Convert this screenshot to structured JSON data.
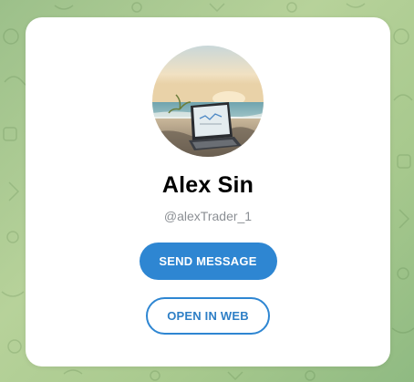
{
  "profile": {
    "name": "Alex Sin",
    "username": "@alexTrader_1",
    "avatar_icon": "avatar-laptop-on-beach"
  },
  "actions": {
    "send_message_label": "SEND MESSAGE",
    "open_in_web_label": "OPEN IN WEB"
  },
  "colors": {
    "accent": "#2e86d2",
    "background": "#a8c98e",
    "card": "#ffffff",
    "username_text": "#8b8f94"
  }
}
